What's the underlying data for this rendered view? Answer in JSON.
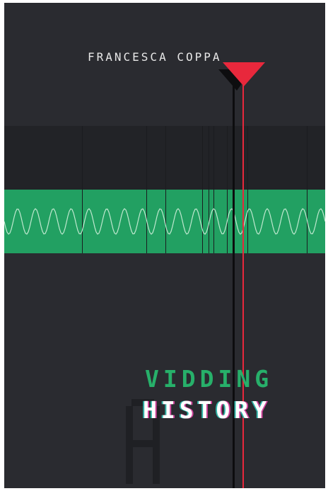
{
  "cover": {
    "author": "FRANCESCA COPPA",
    "title_line1": "VIDDING",
    "title_line2": "HISTORY"
  },
  "colors": {
    "background": "#2a2b30",
    "timeline_dark": "#222327",
    "timeline_green": "#22a062",
    "playhead": "#e8283c",
    "title_green": "#27b06a"
  },
  "icons": [
    "playhead-marker-icon",
    "waveform-icon",
    "ghost-glyph-icon"
  ]
}
